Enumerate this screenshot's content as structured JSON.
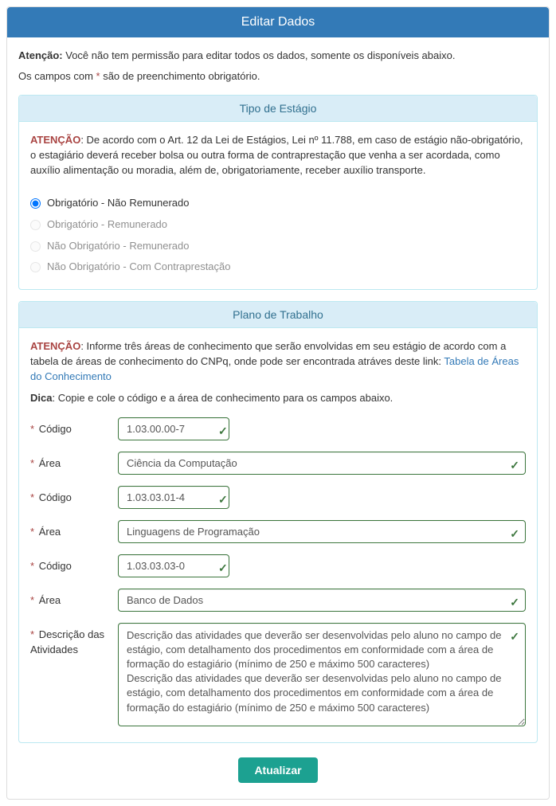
{
  "header": {
    "title": "Editar Dados"
  },
  "intro": {
    "attention_label": "Atenção:",
    "attention_text": " Você não tem permissão para editar todos os dados, somente os disponíveis abaixo.",
    "required_prefix": "Os campos com ",
    "required_suffix": " são de preenchimento obrigatório."
  },
  "tipo": {
    "heading": "Tipo de Estágio",
    "notice_label": "ATENÇÃO",
    "notice_text": ": De acordo com o Art. 12 da Lei de Estágios, Lei nº 11.788, em caso de estágio não-obrigatório, o estagiário deverá receber bolsa ou outra forma de contraprestação que venha a ser acordada, como auxílio alimentação ou moradia, além de, obrigatoriamente, receber auxílio transporte.",
    "options": [
      "Obrigatório - Não Remunerado",
      "Obrigatório - Remunerado",
      "Não Obrigatório - Remunerado",
      "Não Obrigatório - Com Contraprestação"
    ]
  },
  "plano": {
    "heading": "Plano de Trabalho",
    "notice_label": "ATENÇÃO",
    "notice_text": ": Informe três áreas de conhecimento que serão envolvidas em seu estágio de acordo com a tabela de áreas de conhecimento do CNPq, onde pode ser encontrada atráves deste link: ",
    "link_text": "Tabela de Áreas do Conhecimento",
    "hint_label": "Dica",
    "hint_text": ": Copie e cole o código e a área de conhecimento para os campos abaixo.",
    "fields": {
      "codigo_label": "Código",
      "area_label": "Área",
      "descricao_label": "Descrição das Atividades",
      "codigo1": "1.03.00.00-7",
      "area1": "Ciência da Computação",
      "codigo2": "1.03.03.01-4",
      "area2": "Linguagens de Programação",
      "codigo3": "1.03.03.03-0",
      "area3": "Banco de Dados",
      "descricao": "Descrição das atividades que deverão ser desenvolvidas pelo aluno no campo de estágio, com detalhamento dos procedimentos em conformidade com a área de formação do estagiário (mínimo de 250 e máximo 500 caracteres)\nDescrição das atividades que deverão ser desenvolvidas pelo aluno no campo de estágio, com detalhamento dos procedimentos em conformidade com a área de formação do estagiário (mínimo de 250 e máximo 500 caracteres)"
    }
  },
  "actions": {
    "submit": "Atualizar"
  },
  "asterisk": "*"
}
